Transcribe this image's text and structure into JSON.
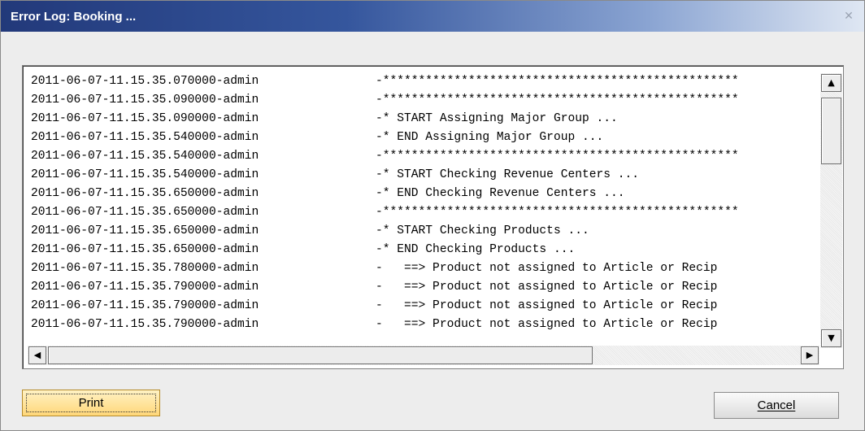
{
  "window": {
    "title": "Error Log: Booking ...",
    "close_glyph": "✕"
  },
  "log": {
    "rows": [
      {
        "ts": "2011-06-07-11.15.35.070000-admin",
        "msg": "-**************************************************"
      },
      {
        "ts": "2011-06-07-11.15.35.090000-admin",
        "msg": "-**************************************************"
      },
      {
        "ts": "2011-06-07-11.15.35.090000-admin",
        "msg": "-* START Assigning Major Group ..."
      },
      {
        "ts": "2011-06-07-11.15.35.540000-admin",
        "msg": "-* END Assigning Major Group ..."
      },
      {
        "ts": "2011-06-07-11.15.35.540000-admin",
        "msg": "-**************************************************"
      },
      {
        "ts": "2011-06-07-11.15.35.540000-admin",
        "msg": "-* START Checking Revenue Centers ..."
      },
      {
        "ts": "2011-06-07-11.15.35.650000-admin",
        "msg": "-* END Checking Revenue Centers ..."
      },
      {
        "ts": "2011-06-07-11.15.35.650000-admin",
        "msg": "-**************************************************"
      },
      {
        "ts": "2011-06-07-11.15.35.650000-admin",
        "msg": "-* START Checking Products ..."
      },
      {
        "ts": "2011-06-07-11.15.35.650000-admin",
        "msg": "-* END Checking Products ..."
      },
      {
        "ts": "2011-06-07-11.15.35.780000-admin",
        "msg": "-   ==> Product not assigned to Article or Recip"
      },
      {
        "ts": "2011-06-07-11.15.35.790000-admin",
        "msg": "-   ==> Product not assigned to Article or Recip"
      },
      {
        "ts": "2011-06-07-11.15.35.790000-admin",
        "msg": "-   ==> Product not assigned to Article or Recip"
      },
      {
        "ts": "2011-06-07-11.15.35.790000-admin",
        "msg": "-   ==> Product not assigned to Article or Recip"
      }
    ]
  },
  "scrollbar": {
    "up_glyph": "▲",
    "down_glyph": "▼",
    "left_glyph": "◀",
    "right_glyph": "▶"
  },
  "buttons": {
    "print_label": "Print",
    "cancel_label": "Cancel"
  }
}
